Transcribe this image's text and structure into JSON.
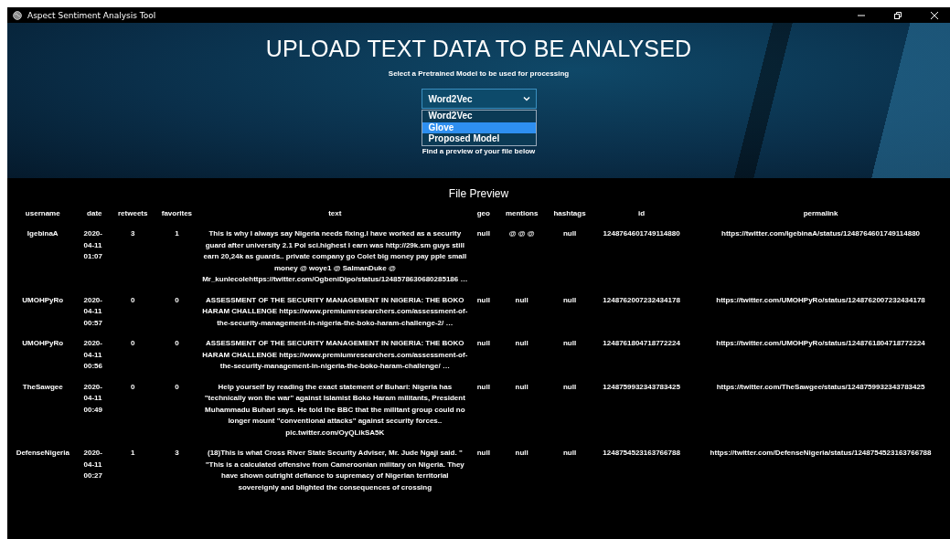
{
  "window": {
    "title": "Aspect Sentiment Analysis Tool"
  },
  "header": {
    "heading": "UPLOAD TEXT DATA TO BE ANALYSED",
    "subtitle": "Select a Pretrained Model to be used for processing",
    "model_select": {
      "value": "Word2Vec",
      "expanded": true,
      "options": [
        {
          "label": "Word2Vec",
          "highlighted": false
        },
        {
          "label": "Glove",
          "highlighted": true
        },
        {
          "label": "Proposed Model",
          "highlighted": false
        }
      ]
    },
    "hint": "Find a preview of your file below"
  },
  "preview": {
    "title": "File Preview",
    "columns": [
      "username",
      "date",
      "retweets",
      "favorites",
      "text",
      "geo",
      "mentions",
      "hashtags",
      "id",
      "permalink"
    ],
    "rows": [
      [
        "IgebinaA",
        "2020-04-11 01:07",
        "3",
        "1",
        "This is why I always say Nigeria needs fixing.I have worked as a security guard after university 2.1 Pol sci.highest I earn was http://29k.sm  guys still earn 20,24k as guards.. private company go Colet big money pay pple small money @ woye1 @ SalmanDuke @ Mr_kunlecolehttps://twitter.com/OgbeniDipo/status/1248578630680285186 …",
        "null",
        "@ @ @",
        "null",
        "1248764601749114880",
        "https://twitter.com/IgebinaA/status/1248764601749114880"
      ],
      [
        "UMOHPyRo",
        "2020-04-11 00:57",
        "0",
        "0",
        "ASSESSMENT OF THE SECURITY MANAGEMENT IN NIGERIA: THE BOKO HARAM CHALLENGE https://www.premiumresearchers.com/assessment-of-the-security-management-in-nigeria-the-boko-haram-challenge-2/ …",
        "null",
        "null",
        "null",
        "1248762007232434178",
        "https://twitter.com/UMOHPyRo/status/1248762007232434178"
      ],
      [
        "UMOHPyRo",
        "2020-04-11 00:56",
        "0",
        "0",
        "ASSESSMENT OF THE SECURITY MANAGEMENT IN NIGERIA: THE BOKO HARAM CHALLENGE https://www.premiumresearchers.com/assessment-of-the-security-management-in-nigeria-the-boko-haram-challenge/ …",
        "null",
        "null",
        "null",
        "1248761804718772224",
        "https://twitter.com/UMOHPyRo/status/1248761804718772224"
      ],
      [
        "TheSawgee",
        "2020-04-11 00:49",
        "0",
        "0",
        "Help yourself by reading the exact statement of Buhari: Nigeria has \"technically won the war\" against Islamist Boko Haram militants, President Muhammadu Buhari says. He told the BBC that the militant group could no longer mount \"conventional attacks\" against security forces.. pic.twitter.com/OyQLikSA5K",
        "null",
        "null",
        "null",
        "1248759932343783425",
        "https://twitter.com/TheSawgee/status/1248759932343783425"
      ],
      [
        "DefenseNigeria",
        "2020-04-11 00:27",
        "1",
        "3",
        "(18)This is what Cross River State Security Adviser, Mr. Jude Ngaji said. \" \"This is a calculated offensive from Cameroonian military on Nigeria. They have shown outright defiance to supremacy of Nigerian territorial sovereignly and blighted the consequences of crossing",
        "null",
        "null",
        "null",
        "1248754523163766788",
        "https://twitter.com/DefenseNigeria/status/1248754523163766788"
      ]
    ]
  }
}
